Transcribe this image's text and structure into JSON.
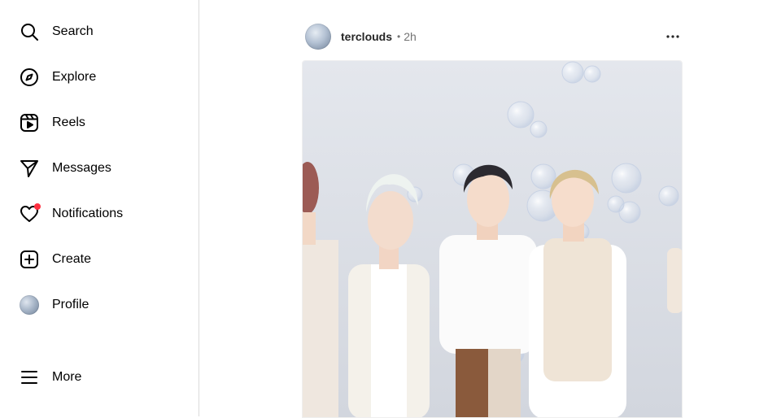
{
  "sidebar": {
    "items": [
      {
        "label": "Search",
        "icon": "search-icon"
      },
      {
        "label": "Explore",
        "icon": "compass-icon"
      },
      {
        "label": "Reels",
        "icon": "reels-icon"
      },
      {
        "label": "Messages",
        "icon": "paper-plane-icon"
      },
      {
        "label": "Notifications",
        "icon": "heart-icon",
        "badge": true
      },
      {
        "label": "Create",
        "icon": "plus-square-icon"
      },
      {
        "label": "Profile",
        "icon": "avatar"
      },
      {
        "label": "More",
        "icon": "hamburger-icon"
      }
    ]
  },
  "post": {
    "username": "terclouds",
    "separator": "•",
    "time": "2h",
    "image_description_icon": "photo"
  },
  "colors": {
    "notification_dot": "#ff3040",
    "divider": "#dbdbdb",
    "muted_text": "#737373"
  }
}
